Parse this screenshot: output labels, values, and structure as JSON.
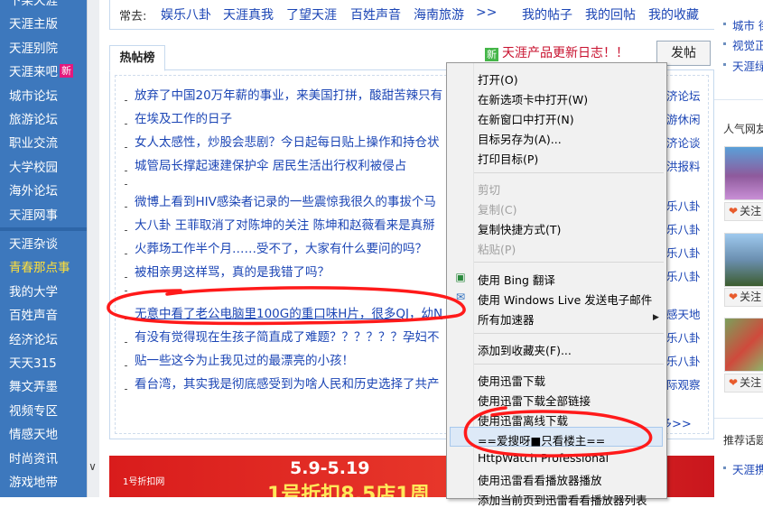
{
  "sidebar": {
    "items": [
      "下某天涯",
      "天涯主版",
      "天涯别院",
      "天涯来吧",
      "城市论坛",
      "旅游论坛",
      "职业交流",
      "大学校园",
      "海外论坛",
      "天涯网事"
    ],
    "new_badge": "新",
    "items2": [
      "天涯杂谈",
      "青春那点事",
      "我的大学",
      "百姓声音",
      "经济论坛",
      "天天315",
      "舞文弄墨",
      "视频专区",
      "情感天地",
      "时尚资讯",
      "游戏地带"
    ]
  },
  "topbar": {
    "caption": "常去:",
    "links": [
      "娱乐八卦",
      "天涯真我",
      "了望天涯",
      "百姓声音",
      "海南旅游",
      ">>"
    ],
    "my_links": [
      "我的帖子",
      "我的回帖",
      "我的收藏"
    ]
  },
  "panel": {
    "tab": "热帖榜",
    "update_log": "天涯产品更新日志！！",
    "update_icon": "新",
    "post_button": "发帖",
    "more": "多>>"
  },
  "posts": [
    {
      "title": "放弃了中国20万年薪的事业，来美国打拼，酸甜苦辣只有",
      "forum": "济论坛"
    },
    {
      "title": "在埃及工作的日子",
      "forum": "游休闲"
    },
    {
      "title": "女人太感性，炒股会悲剧？今日起每日贴上操作和持仓状",
      "forum": "济论谈"
    },
    {
      "title": "城管局长撑起速建保护伞 居民生活出行权利被侵占",
      "forum": "洪报料"
    },
    {
      "title": "微博上看到HIV感染者记录的一些震惊我很久的事拔个马",
      "forum": "乐八卦"
    },
    {
      "title": "大八卦 王菲取消了对陈坤的关注 陈坤和赵薇看来是真掰",
      "forum": "乐八卦"
    },
    {
      "title": "火葬场工作半个月……受不了，大家有什么要问的吗？",
      "forum": "乐八卦"
    },
    {
      "title": "被相亲男这样骂，真的是我错了吗？",
      "forum": "乐八卦"
    },
    {
      "title": "无意中看了老公电脑里100G的重口味H片，很多QJ，幼N",
      "forum": "感天地"
    },
    {
      "title": "有没有觉得现在生孩子简直成了难题？？？？？？孕妇不",
      "forum": "乐八卦"
    },
    {
      "title": "贴一些这今为止我见过的最漂亮的小孩！",
      "forum": "乐八卦"
    },
    {
      "title": "看台湾，其实我是彻底感受到为啥人民和历史选择了共产",
      "forum": "际观察"
    }
  ],
  "banner": {
    "date": "5.9-5.19",
    "sub": "1号折扣8.5店1周",
    "brand": "1号折扣网"
  },
  "right": {
    "links": [
      "城市 街",
      "视觉正",
      "天涯绿"
    ],
    "popular_title": "人气网友",
    "follow": "关注",
    "recommend_title": "推荐话题",
    "bottom_link": "天涯携"
  },
  "menu": {
    "items": [
      {
        "label": "打开(O)",
        "enabled": true
      },
      {
        "label": "在新选项卡中打开(W)",
        "enabled": true
      },
      {
        "label": "在新窗口中打开(N)",
        "enabled": true
      },
      {
        "label": "目标另存为(A)...",
        "enabled": true
      },
      {
        "label": "打印目标(P)",
        "enabled": true
      },
      {
        "label": "剪切",
        "enabled": false
      },
      {
        "label": "复制(C)",
        "enabled": false
      },
      {
        "label": "复制快捷方式(T)",
        "enabled": true
      },
      {
        "label": "粘贴(P)",
        "enabled": false
      },
      {
        "label": "使用 Bing 翻译",
        "enabled": true
      },
      {
        "label": "使用 Windows Live 发送电子邮件",
        "enabled": true
      },
      {
        "label": "所有加速器",
        "enabled": true
      },
      {
        "label": "添加到收藏夹(F)...",
        "enabled": true
      },
      {
        "label": "使用迅雷下载",
        "enabled": true
      },
      {
        "label": "使用迅雷下载全部链接",
        "enabled": true
      },
      {
        "label": "使用迅雷离线下载",
        "enabled": true
      },
      {
        "label": "==爱搜呀■只看楼主==",
        "enabled": true
      },
      {
        "label": "HttpWatch Professional",
        "enabled": true
      },
      {
        "label": "使用迅雷看看播放器播放",
        "enabled": true
      },
      {
        "label": "添加当前页到迅雷看看播放器列表",
        "enabled": true
      }
    ]
  },
  "colors": {
    "sidebar_bg": "#3d78bd",
    "link": "#1b45b5",
    "annotation": "#ff1a1a",
    "highlight_text": "#ffe03a"
  }
}
